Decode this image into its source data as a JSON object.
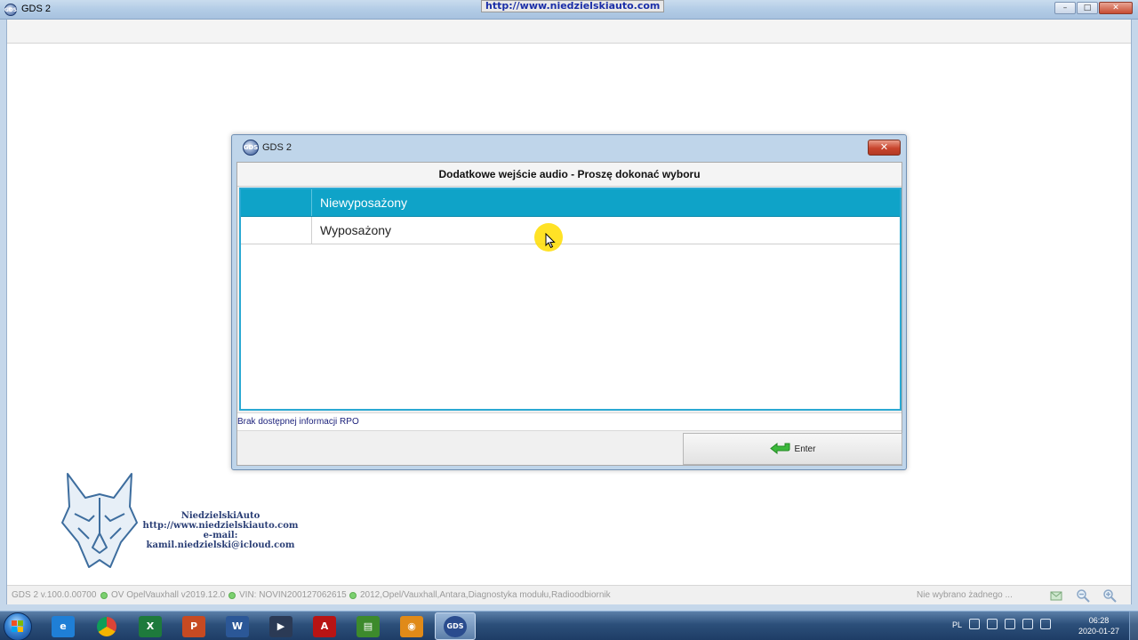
{
  "window": {
    "title": "GDS 2",
    "watermark_url": "http://www.niedzielskiauto.com",
    "controls": {
      "minimize": "–",
      "maximize": "□",
      "close": "✕"
    }
  },
  "dialog": {
    "title": "GDS 2",
    "icon_label": "GDS",
    "close_label": "✕",
    "heading": "Dodatkowe wejście audio - Proszę dokonać wyboru",
    "options": [
      {
        "label": "Niewyposażony",
        "selected": true
      },
      {
        "label": "Wyposażony",
        "selected": false
      }
    ],
    "info_text": "Brak dostępnej informacji RPO",
    "enter_label": "Enter",
    "colors": {
      "selected_row": "#0fa3c8",
      "list_border": "#2ba9d3",
      "enter_arrow": "#3cb83c"
    }
  },
  "branding": {
    "name": "NiedzielskiAuto",
    "url": "http://www.niedzielskiauto.com",
    "email": "e-mail: kamil.niedzielski@icloud.com"
  },
  "statusbar": {
    "version": "GDS 2 v.100.0.00700",
    "database": "OV OpelVauxhall v2019.12.0",
    "vin": "VIN: NOVIN200127062615",
    "vehicle": "2012,Opel/Vauxhall,Antara,Diagnostyka modułu,Radioodbiornik",
    "selection": "Nie wybrano żadnego ...",
    "icons": [
      "mail-icon",
      "zoom-out-icon",
      "zoom-in-icon"
    ],
    "status_color": "#7bd06f"
  },
  "taskbar": {
    "apps": [
      {
        "name": "internet-explorer",
        "glyph": "e",
        "color": "#1f7fd6"
      },
      {
        "name": "chrome",
        "glyph": "",
        "color": "#e0b02a"
      },
      {
        "name": "excel",
        "glyph": "X",
        "color": "#1e7a3c"
      },
      {
        "name": "powerpoint",
        "glyph": "P",
        "color": "#c74a22"
      },
      {
        "name": "word",
        "glyph": "W",
        "color": "#2b5797"
      },
      {
        "name": "media-player",
        "glyph": "▶",
        "color": "#2b3a55"
      },
      {
        "name": "acrobat",
        "glyph": "A",
        "color": "#b81414"
      },
      {
        "name": "spreadsheet-tool",
        "glyph": "▤",
        "color": "#3d8a2c"
      },
      {
        "name": "camera-app",
        "glyph": "◉",
        "color": "#e08a18"
      },
      {
        "name": "gds",
        "glyph": "GDS",
        "color": "#2a4c8e",
        "active": true
      }
    ],
    "tray": {
      "language": "PL",
      "time": "06:28",
      "date": "2020-01-27"
    }
  }
}
